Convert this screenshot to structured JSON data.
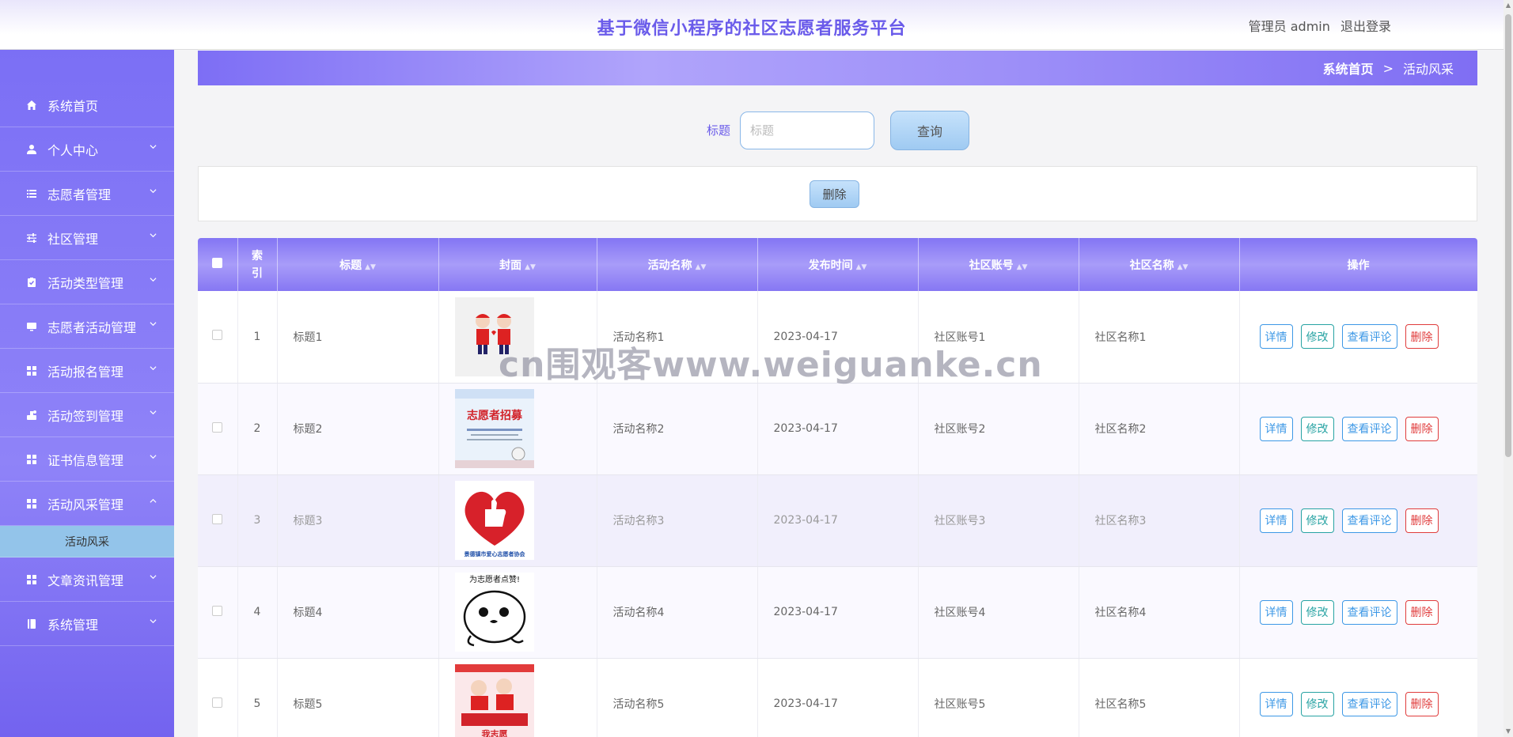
{
  "header": {
    "title": "基于微信小程序的社区志愿者服务平台",
    "user_label": "管理员 admin",
    "logout_label": "退出登录"
  },
  "sidebar": {
    "items": [
      {
        "label": "系统首页",
        "icon": "home-icon"
      },
      {
        "label": "个人中心",
        "icon": "user-icon"
      },
      {
        "label": "志愿者管理",
        "icon": "list-icon"
      },
      {
        "label": "社区管理",
        "icon": "sliders-icon"
      },
      {
        "label": "活动类型管理",
        "icon": "clipboard-icon"
      },
      {
        "label": "志愿者活动管理",
        "icon": "monitor-icon"
      },
      {
        "label": "活动报名管理",
        "icon": "grid-icon"
      },
      {
        "label": "活动签到管理",
        "icon": "stamp-icon"
      },
      {
        "label": "证书信息管理",
        "icon": "grid-icon"
      },
      {
        "label": "活动风采管理",
        "icon": "grid-icon"
      },
      {
        "label": "文章资讯管理",
        "icon": "grid-icon"
      },
      {
        "label": "系统管理",
        "icon": "book-icon"
      }
    ],
    "active_submenu": "活动风采"
  },
  "breadcrumb": {
    "home": "系统首页",
    "separator": ">",
    "current": "活动风采"
  },
  "search": {
    "label": "标题",
    "placeholder": "标题",
    "button": "查询"
  },
  "actions": {
    "delete": "删除"
  },
  "table": {
    "headers": {
      "index": "索\n引",
      "title": "标题",
      "cover": "封面",
      "activity_name": "活动名称",
      "publish_time": "发布时间",
      "community_account": "社区账号",
      "community_name": "社区名称",
      "operations": "操作"
    },
    "op_labels": {
      "detail": "详情",
      "edit": "修改",
      "comments": "查看评论",
      "delete": "删除"
    },
    "rows": [
      {
        "index": "1",
        "title": "标题1",
        "activity_name": "活动名称1",
        "publish_time": "2023-04-17",
        "community_account": "社区账号1",
        "community_name": "社区名称1"
      },
      {
        "index": "2",
        "title": "标题2",
        "activity_name": "活动名称2",
        "publish_time": "2023-04-17",
        "community_account": "社区账号2",
        "community_name": "社区名称2"
      },
      {
        "index": "3",
        "title": "标题3",
        "activity_name": "活动名称3",
        "publish_time": "2023-04-17",
        "community_account": "社区账号3",
        "community_name": "社区名称3"
      },
      {
        "index": "4",
        "title": "标题4",
        "activity_name": "活动名称4",
        "publish_time": "2023-04-17",
        "community_account": "社区账号4",
        "community_name": "社区名称4"
      },
      {
        "index": "5",
        "title": "标题5",
        "activity_name": "活动名称5",
        "publish_time": "2023-04-17",
        "community_account": "社区账号5",
        "community_name": "社区名称5"
      }
    ],
    "cover_texts": {
      "row2": "志愿者招募",
      "row3": "景德镇市爱心志愿者协会",
      "row4": "为志愿者点赞!",
      "row5": "我志愿"
    }
  },
  "watermark": "cn围观客www.weiguanke.cn",
  "colors": {
    "accent": "#6a5bea",
    "sidebar": "#7b6ff5",
    "submenu_active": "#93c4ea"
  }
}
